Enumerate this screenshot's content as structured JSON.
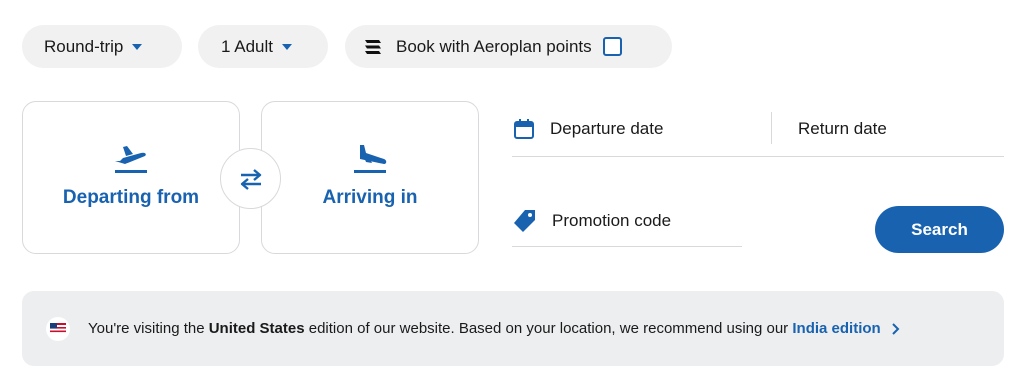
{
  "top_bar": {
    "trip_type": "Round-trip",
    "passengers": "1 Adult",
    "points_label": "Book with Aeroplan points"
  },
  "route": {
    "from_label": "Departing from",
    "to_label": "Arriving in"
  },
  "dates": {
    "departure_label": "Departure date",
    "return_label": "Return date"
  },
  "promo": {
    "label": "Promotion code"
  },
  "search": {
    "label": "Search"
  },
  "banner": {
    "text_before": "You're visiting the ",
    "country": "United States",
    "text_after": " edition of our website. Based on your location, we recommend using our ",
    "link_text": "India edition"
  },
  "colors": {
    "accent": "#1862b0",
    "pill_bg": "#f1f1f2",
    "banner_bg": "#edeef0",
    "border": "#d9d9dc"
  },
  "icons": {
    "trip_caret": "caret-down-icon",
    "pax_caret": "caret-down-icon",
    "points": "aeroplan-logo-icon",
    "departure": "plane-departure-icon",
    "arrival": "plane-arrival-icon",
    "swap": "swap-arrows-icon",
    "calendar": "calendar-icon",
    "promo": "tag-icon",
    "flag": "us-flag-icon",
    "chevron": "chevron-right-icon"
  }
}
